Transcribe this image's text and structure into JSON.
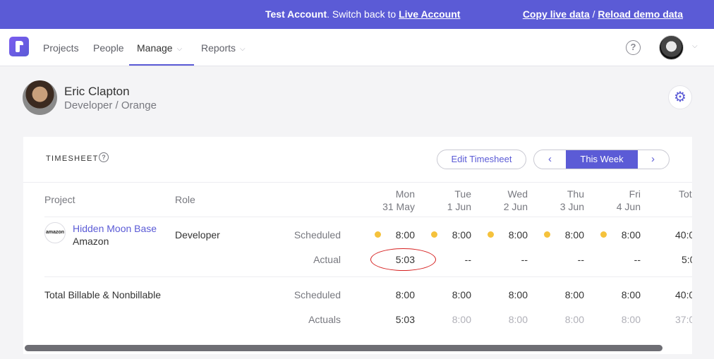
{
  "banner": {
    "account_bold": "Test Account",
    "switch_text": ". Switch back to ",
    "live_link": "Live Account",
    "copy_link": "Copy live data",
    "separator": " / ",
    "reload_link": "Reload demo data",
    "color": "#5b5bd6"
  },
  "nav": {
    "items": [
      {
        "label": "Projects"
      },
      {
        "label": "People"
      },
      {
        "label": "Manage"
      },
      {
        "label": "Reports"
      }
    ],
    "help_glyph": "?"
  },
  "profile": {
    "name": "Eric Clapton",
    "role": "Developer / Orange"
  },
  "timesheet": {
    "title": "TIMESHEET",
    "edit_button": "Edit Timesheet",
    "week_label": "This Week",
    "prev_glyph": "‹",
    "next_glyph": "›",
    "columns": {
      "project": "Project",
      "role": "Role"
    },
    "days": [
      {
        "day": "Mon",
        "date": "31 May"
      },
      {
        "day": "Tue",
        "date": "1 Jun"
      },
      {
        "day": "Wed",
        "date": "2 Jun"
      },
      {
        "day": "Thu",
        "date": "3 Jun"
      },
      {
        "day": "Fri",
        "date": "4 Jun"
      },
      {
        "day": "Tot",
        "date": ""
      }
    ],
    "project_row": {
      "logo_text": "amazon",
      "project": "Hidden Moon Base",
      "client": "Amazon",
      "role": "Developer",
      "scheduled_label": "Scheduled",
      "actual_label": "Actual",
      "scheduled": [
        "8:00",
        "8:00",
        "8:00",
        "8:00",
        "8:00",
        "40:0"
      ],
      "actual": [
        "5:03",
        "--",
        "--",
        "--",
        "--",
        "5:0"
      ]
    },
    "total_row": {
      "label": "Total Billable & Nonbillable",
      "scheduled_label": "Scheduled",
      "actuals_label": "Actuals",
      "scheduled": [
        "8:00",
        "8:00",
        "8:00",
        "8:00",
        "8:00",
        "40:0"
      ],
      "actuals": [
        "5:03",
        "8:00",
        "8:00",
        "8:00",
        "8:00",
        "37:0"
      ]
    }
  }
}
